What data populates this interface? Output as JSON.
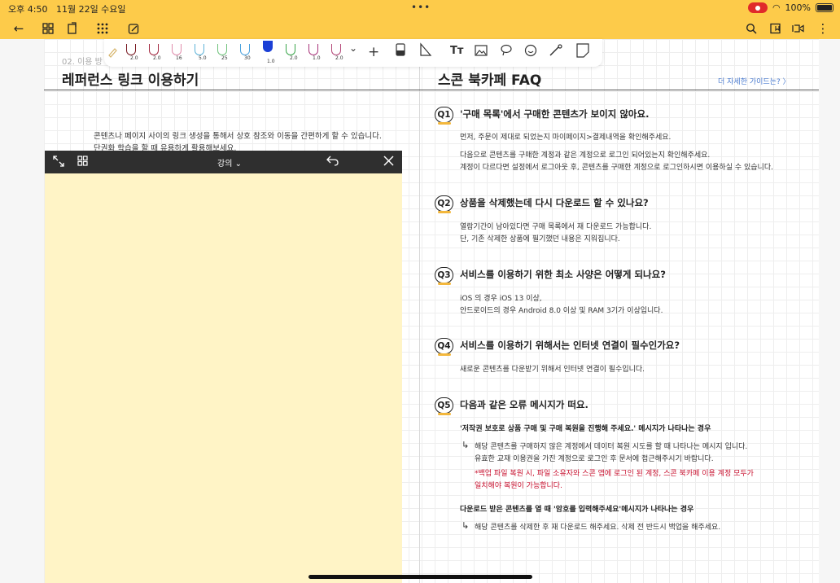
{
  "status": {
    "time": "오후 4:50",
    "date": "11월 22일 수요일",
    "battery": "100%"
  },
  "pen_sizes": [
    "2.0",
    "2.0",
    "16",
    "5.0",
    "25",
    "30",
    "1.0",
    "2.0",
    "1.0",
    "2.0"
  ],
  "colors": {
    "topbar": "#fdcb4a",
    "memo": "#fff4c6",
    "memo_bar": "#2f2f2f",
    "accent_orange": "#f3b73c",
    "link_blue": "#4a7bd0",
    "warning_red": "#c8102e"
  },
  "left_page": {
    "crumb": "02. 이용 방",
    "title": "레퍼런스 링크 이용하기",
    "intro_line1": "콘텐츠나 페이지 사이의 링크 생성을 통해서 상호 참조와 이동을 간편하게 할 수 있습니다.",
    "intro_line2": "단권화 학습을 할 때 유용하게 활용해보세요."
  },
  "memo": {
    "title": "강의 ⌄"
  },
  "right_page": {
    "title": "스콘 북카페 FAQ",
    "more_link": "더 자세한 가이드는? 〉"
  },
  "faq": [
    {
      "badge": "Q1",
      "question": "'구매 목록'에서 구매한 콘텐츠가 보이지 않아요.",
      "a1": "먼저, 주문이 제대로 되었는지 마이페이지>결제내역을 확인해주세요.",
      "a2": "다음으로 콘텐츠를 구매한 계정과 같은 계정으로 로그인 되어있는지 확인해주세요.",
      "a3": "계정이 다르다면 설정에서 로그아웃 후, 콘텐츠를 구매한 계정으로 로그인하시면 이용하실 수 있습니다."
    },
    {
      "badge": "Q2",
      "question": "상품을 삭제했는데 다시 다운로드 할 수 있나요?",
      "a1": "열람기간이 남아있다면 구매 목록에서 재 다운로드 가능합니다.",
      "a2": "단, 기존 삭제한 상품에 필기했던 내용은 지워집니다."
    },
    {
      "badge": "Q3",
      "question": "서비스를 이용하기 위한 최소 사양은 어떻게 되나요?",
      "a1": "iOS 의 경우 iOS 13 이상,",
      "a2": "안드로이드의 경우 Android 8.0 이상 및 RAM 3기가 이상입니다."
    },
    {
      "badge": "Q4",
      "question": "서비스를 이용하기 위해서는 인터넷 연결이 필수인가요?",
      "a1": "새로운 콘텐츠를 다운받기 위해서 인터넷 연결이 필수입니다."
    },
    {
      "badge": "Q5",
      "question": "다음과 같은 오류 메시지가 떠요.",
      "case1": "'저작권 보호로 상품 구매 및 구매 복원을 진행해 주세요.' 메시지가 나타나는 경우",
      "case1_a1": "해당 콘텐츠를 구매하지 않은 계정에서 데이터 복원 시도를 할 때 나타나는 메시지 입니다.",
      "case1_a2": "유효한 교재 이용권을 가진 계정으로 로그인 후 문서에 접근해주시기 바랍니다.",
      "case1_warn1": "*백업 파일 복원 시, 파일 소유자와 스콘 앱에 로그인 된 계정, 스콘 북카페 이용 계정 모두가",
      "case1_warn2": "일치해야 복원이 가능합니다.",
      "case2": "다운로드 받은 콘텐츠를 열 때 '암호를 입력해주세요'메시지가 나타나는 경우",
      "case2_a1": "해당 콘텐츠를 삭제한 후 재 다운로드 해주세요. 삭제 전 반드시 백업을 해주세요."
    }
  ]
}
